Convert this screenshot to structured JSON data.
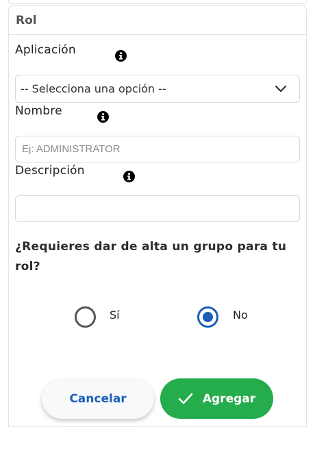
{
  "panel": {
    "title": "Rol"
  },
  "form": {
    "application": {
      "label": "Aplicación",
      "icon": "info-icon",
      "selected": "-- Selecciona una opción --"
    },
    "name": {
      "label": "Nombre",
      "icon": "info-icon",
      "value": "",
      "placeholder": "Ej: ADMINISTRATOR"
    },
    "description": {
      "label": "Descripción",
      "icon": "info-icon",
      "value": "",
      "placeholder": ""
    },
    "group_question": "¿Requieres dar de alta un grupo para tu rol?",
    "options": [
      {
        "label": "Sí",
        "checked": false
      },
      {
        "label": "No",
        "checked": true
      }
    ]
  },
  "actions": {
    "cancel_label": "Cancelar",
    "add_label": "Agregar"
  },
  "colors": {
    "primary_blue": "#1a5fb4",
    "success_green": "#25ac4c"
  }
}
